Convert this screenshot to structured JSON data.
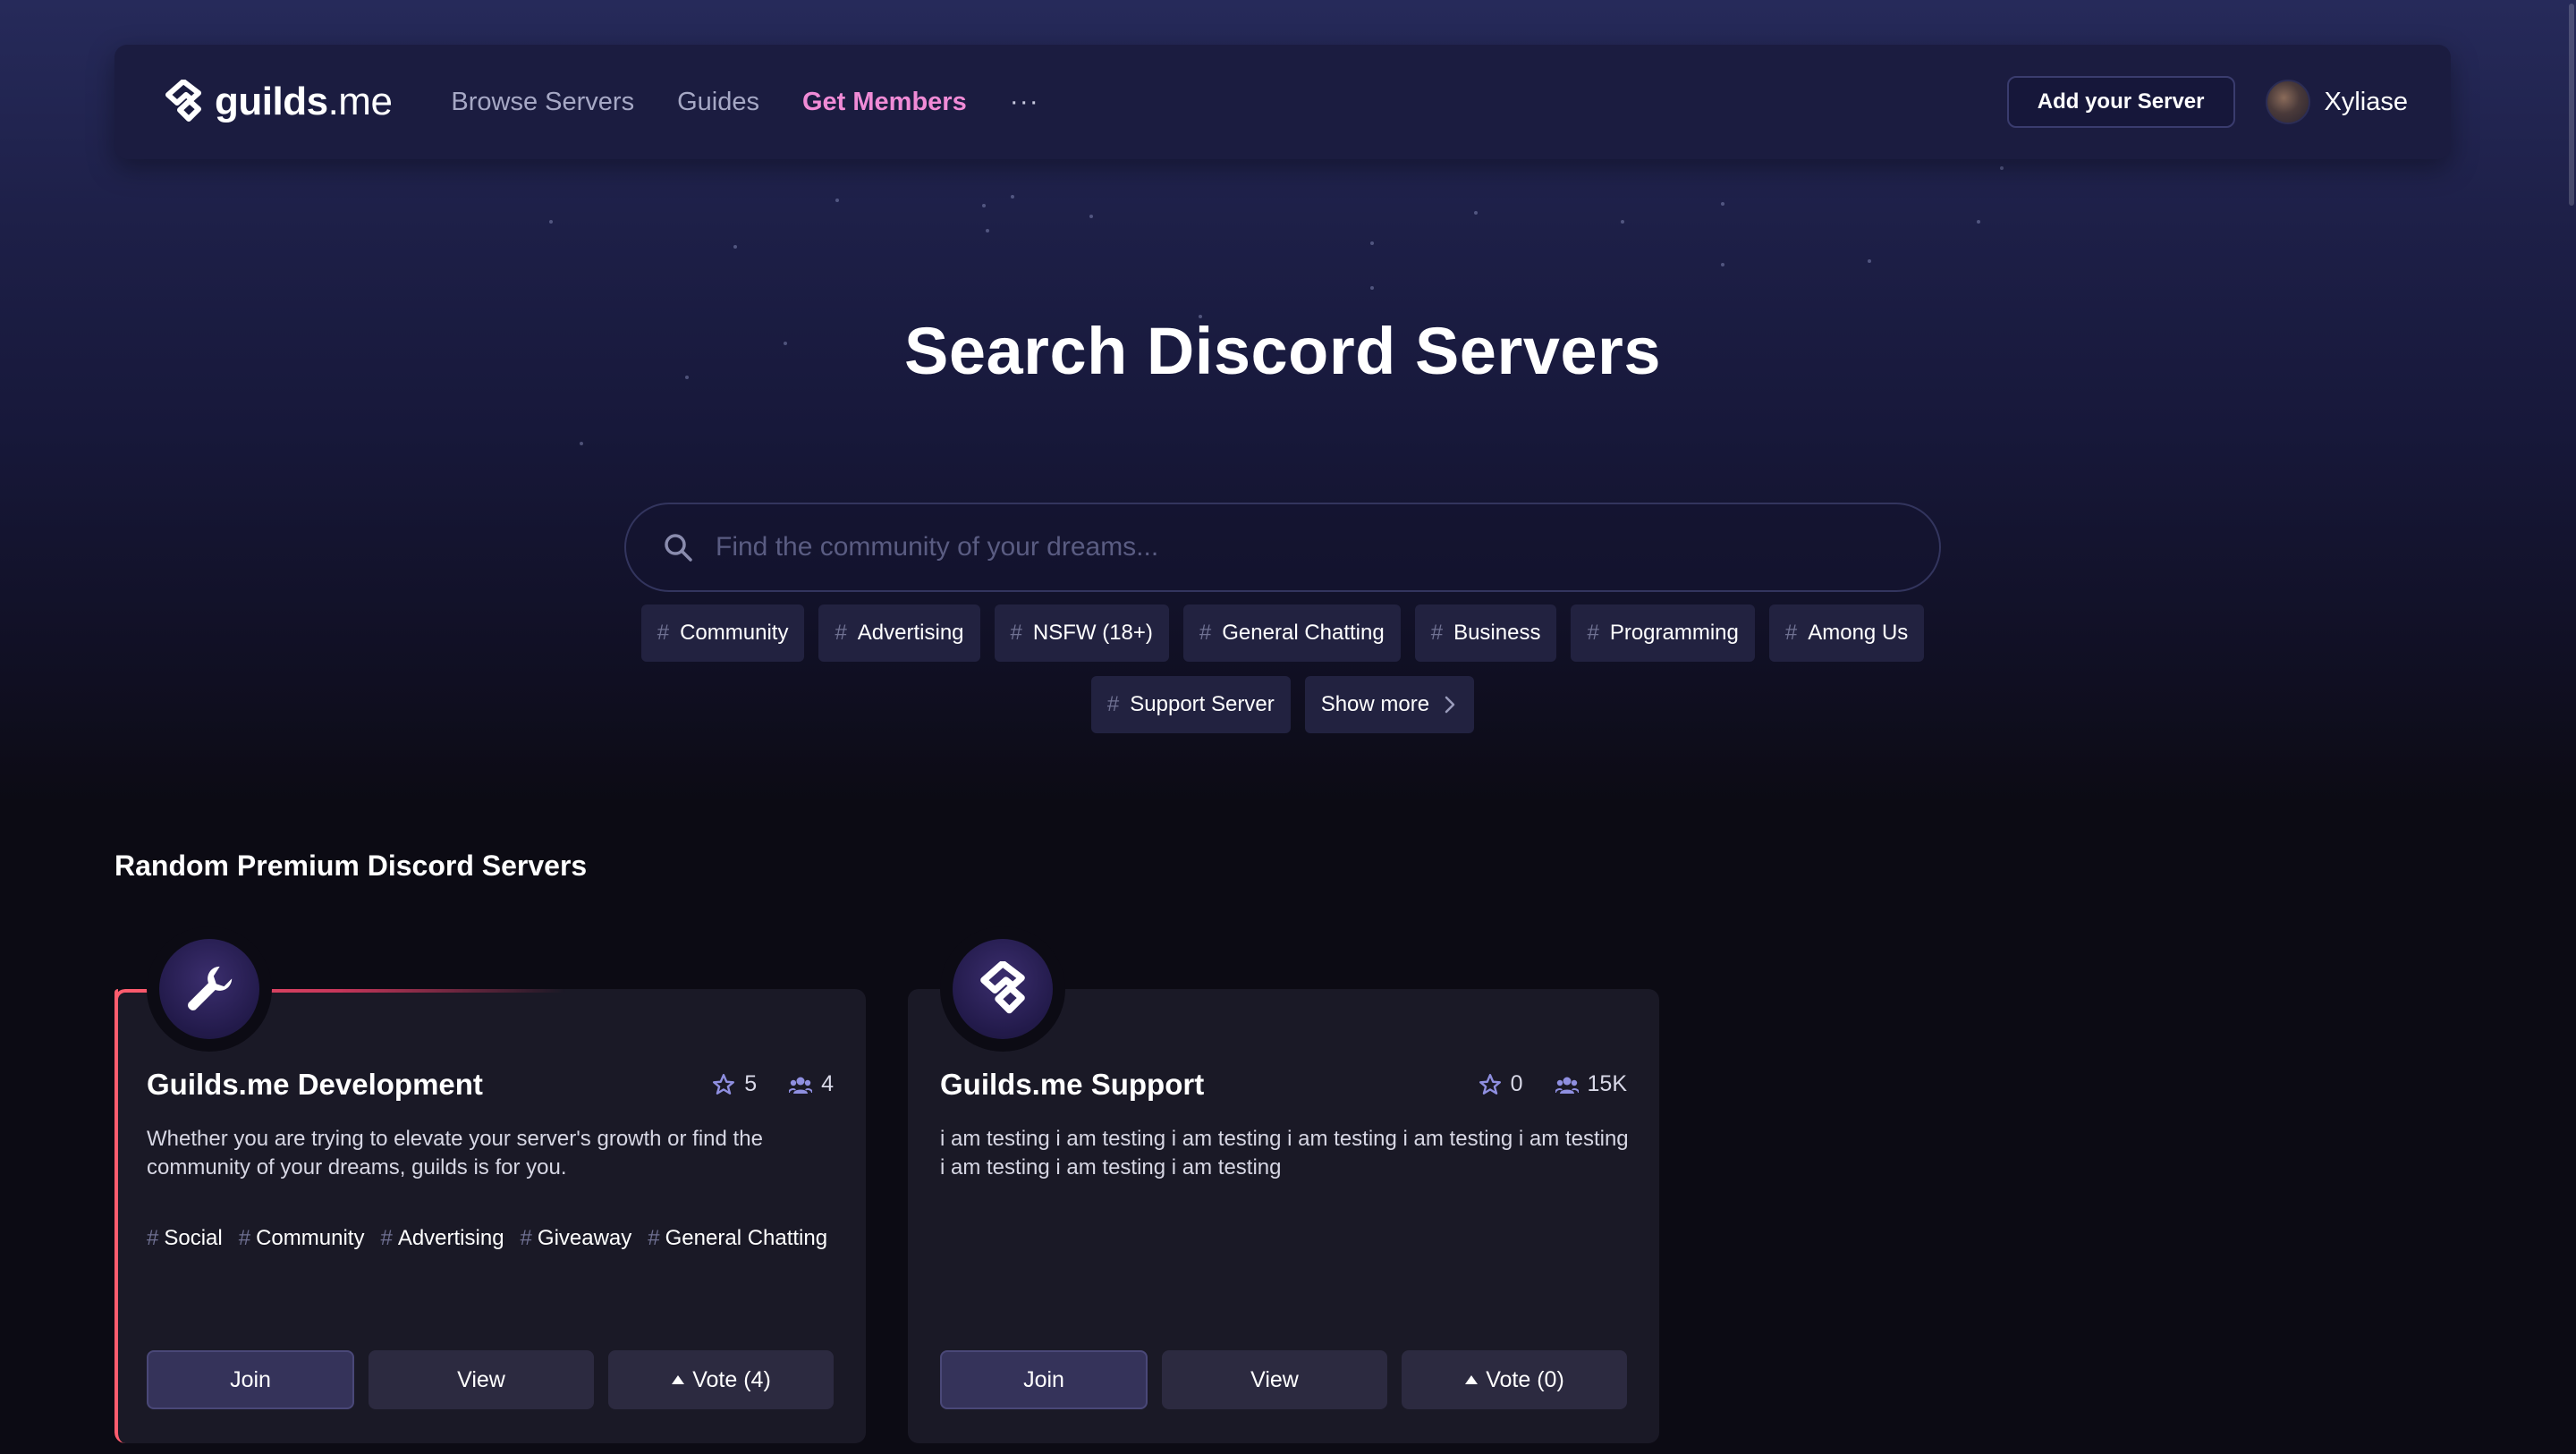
{
  "nav": {
    "brand_bold": "guilds",
    "brand_tld": ".me",
    "links": [
      {
        "label": "Browse Servers"
      },
      {
        "label": "Guides"
      },
      {
        "label": "Get Members"
      }
    ],
    "more_label": "···",
    "add_server_label": "Add your Server",
    "user_name": "Xyliase"
  },
  "hero": {
    "title": "Search Discord Servers",
    "search_placeholder": "Find the community of your dreams..."
  },
  "tags": {
    "hash": "#",
    "row1": [
      "Community",
      "Advertising",
      "NSFW (18+)",
      "General Chatting",
      "Business",
      "Programming",
      "Among Us"
    ],
    "row2": [
      "Support Server"
    ],
    "show_more_label": "Show more"
  },
  "section": {
    "title": "Random Premium Discord Servers"
  },
  "cards": [
    {
      "icon": "wrench-icon",
      "name": "Guilds.me Development",
      "stars": "5",
      "members": "4",
      "description": "Whether you are trying to elevate your server's growth or find the community of your dreams, guilds is for you.",
      "tags": [
        "Social",
        "Community",
        "Advertising",
        "Giveaway",
        "General Chatting"
      ],
      "join_label": "Join",
      "view_label": "View",
      "vote_label": "Vote (4)"
    },
    {
      "icon": "guilds-logo-icon",
      "name": "Guilds.me Support",
      "stars": "0",
      "members": "15K",
      "description": "i am testing i am testing i am testing i am testing i am testing i am testing i am testing i am testing i am testing",
      "tags": [],
      "join_label": "Join",
      "view_label": "View",
      "vote_label": "Vote (0)"
    }
  ],
  "colors": {
    "accent_pink": "#f08bd6",
    "card_bg": "#1a1926",
    "premium_border": "#ff5d6e"
  }
}
